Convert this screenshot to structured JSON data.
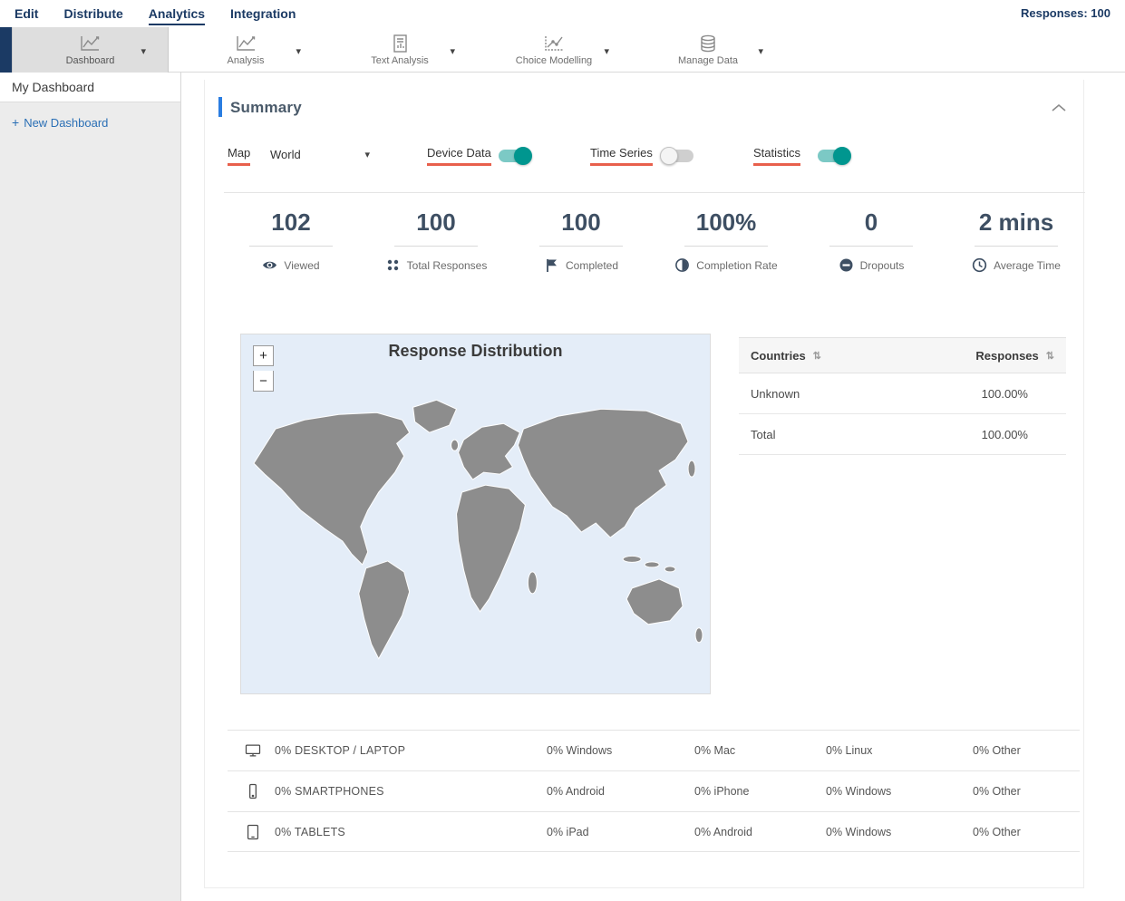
{
  "topnav": {
    "items": [
      {
        "label": "Edit",
        "active": false
      },
      {
        "label": "Distribute",
        "active": false
      },
      {
        "label": "Analytics",
        "active": true
      },
      {
        "label": "Integration",
        "active": false
      }
    ],
    "responses_label": "Responses: 100"
  },
  "toolbar": {
    "items": [
      {
        "label": "Dashboard",
        "selected": true
      },
      {
        "label": "Analysis",
        "selected": false
      },
      {
        "label": "Text Analysis",
        "selected": false
      },
      {
        "label": "Choice Modelling",
        "selected": false
      },
      {
        "label": "Manage Data",
        "selected": false
      }
    ]
  },
  "sidebar": {
    "current_item": "My Dashboard",
    "new_dashboard_label": "New Dashboard",
    "plus_glyph": "+"
  },
  "summary": {
    "title": "Summary",
    "controls": {
      "map_label": "Map",
      "map_select_value": "World",
      "device_data_label": "Device Data",
      "device_data_on": true,
      "time_series_label": "Time Series",
      "time_series_on": false,
      "statistics_label": "Statistics",
      "statistics_on": true
    },
    "stats": [
      {
        "value": "102",
        "label": "Viewed"
      },
      {
        "value": "100",
        "label": "Total Responses"
      },
      {
        "value": "100",
        "label": "Completed"
      },
      {
        "value": "100%",
        "label": "Completion Rate"
      },
      {
        "value": "0",
        "label": "Dropouts"
      },
      {
        "value": "2 mins",
        "label": "Average Time"
      }
    ],
    "map": {
      "title": "Response Distribution",
      "zoom_in_glyph": "+",
      "zoom_out_glyph": "−"
    },
    "countries_table": {
      "headers": [
        "Countries",
        "Responses"
      ],
      "sort_glyph": "⇅",
      "rows": [
        {
          "country": "Unknown",
          "responses": "100.00%"
        },
        {
          "country": "Total",
          "responses": "100.00%"
        }
      ]
    },
    "devices": [
      {
        "label": "0% DESKTOP / LAPTOP",
        "cols": [
          "0% Windows",
          "0% Mac",
          "0% Linux",
          "0% Other"
        ]
      },
      {
        "label": "0% SMARTPHONES",
        "cols": [
          "0% Android",
          "0% iPhone",
          "0% Windows",
          "0% Other"
        ]
      },
      {
        "label": "0% TABLETS",
        "cols": [
          "0% iPad",
          "0% Android",
          "0% Windows",
          "0% Other"
        ]
      }
    ]
  },
  "glyphs": {
    "caret_down": "▾"
  },
  "colors": {
    "navy": "#1b3a64",
    "teal_on": "#00968f",
    "red_underline": "#e8604c",
    "accent_blue": "#2a7de1",
    "map_bg": "#e4edf8",
    "map_land": "#8d8d8d"
  }
}
